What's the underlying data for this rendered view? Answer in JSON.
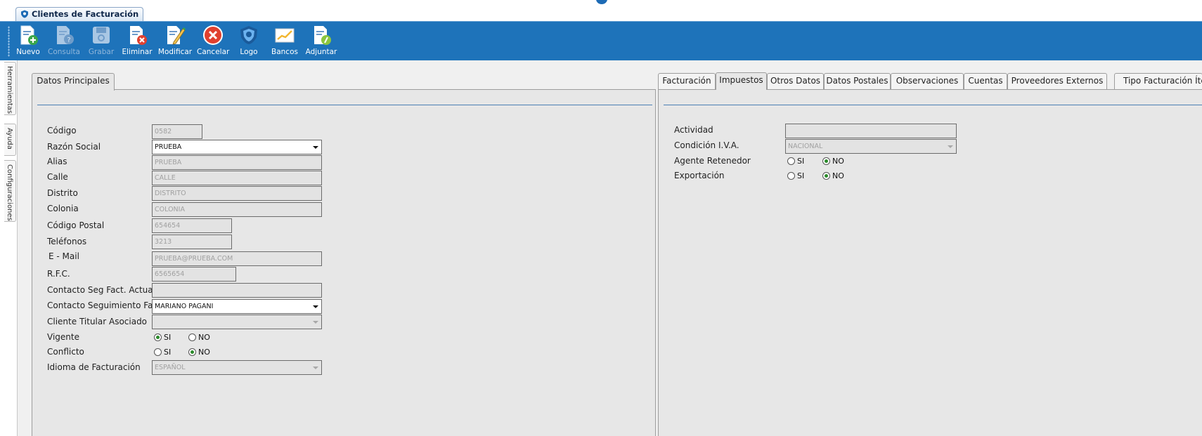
{
  "window": {
    "tab_title": "Clientes de Facturación"
  },
  "toolbar": {
    "buttons": [
      {
        "label": "Nuevo",
        "icon": "new-document-icon",
        "enabled": true
      },
      {
        "label": "Consulta",
        "icon": "query-document-icon",
        "enabled": false
      },
      {
        "label": "Grabar",
        "icon": "save-disk-icon",
        "enabled": false
      },
      {
        "label": "Eliminar",
        "icon": "delete-document-icon",
        "enabled": true
      },
      {
        "label": "Modificar",
        "icon": "edit-document-icon",
        "enabled": true
      },
      {
        "label": "Cancelar",
        "icon": "cancel-icon",
        "enabled": true
      },
      {
        "label": "Logo",
        "icon": "logo-icon",
        "enabled": true
      },
      {
        "label": "Bancos",
        "icon": "chart-icon",
        "enabled": true
      },
      {
        "label": "Adjuntar",
        "icon": "attach-document-icon",
        "enabled": true
      }
    ]
  },
  "side_tabs": [
    "Herramientas",
    "Ayuda",
    "Configuraciones"
  ],
  "left_pane": {
    "tab": "Datos Principales",
    "fields": {
      "codigo": {
        "label": "Código",
        "value": "0582"
      },
      "razon_social": {
        "label": "Razón Social",
        "value": "PRUEBA"
      },
      "alias": {
        "label": "Alias",
        "value": "PRUEBA"
      },
      "calle": {
        "label": "Calle",
        "value": "CALLE"
      },
      "distrito": {
        "label": "Distrito",
        "value": "DISTRITO"
      },
      "colonia": {
        "label": "Colonia",
        "value": "COLONIA"
      },
      "codigo_postal": {
        "label": "Código Postal",
        "value": "654654"
      },
      "telefonos": {
        "label": "Teléfonos",
        "value": "3213"
      },
      "email": {
        "label": "E - Mail",
        "value": "PRUEBA@PRUEBA.COM"
      },
      "rfc": {
        "label": "R.F.C.",
        "value": "6565654"
      },
      "contacto_seg_actual": {
        "label": "Contacto Seg Fact. Actual",
        "value": ""
      },
      "contacto_seguimiento": {
        "label": "Contacto Seguimiento Fact.",
        "value": "MARIANO PAGANI"
      },
      "cliente_titular": {
        "label": "Cliente Titular Asociado",
        "value": ""
      },
      "vigente": {
        "label": "Vigente",
        "options": [
          "SI",
          "NO"
        ],
        "selected": "SI"
      },
      "conflicto": {
        "label": "Conflicto",
        "options": [
          "SI",
          "NO"
        ],
        "selected": "NO"
      },
      "idioma": {
        "label": "Idioma de Facturación",
        "value": "ESPAÑOL"
      }
    }
  },
  "right_pane": {
    "tabs": [
      "Facturación",
      "Impuestos",
      "Otros Datos",
      "Datos Postales",
      "Observaciones",
      "Cuentas",
      "Proveedores Externos",
      "Tipo Facturación Íte"
    ],
    "active_tab": "Impuestos",
    "fields": {
      "actividad": {
        "label": "Actividad",
        "value": ""
      },
      "condicion_iva": {
        "label": "Condición I.V.A.",
        "value": "NACIONAL"
      },
      "agente_retenedor": {
        "label": "Agente Retenedor",
        "options": [
          "SI",
          "NO"
        ],
        "selected": "NO"
      },
      "exportacion": {
        "label": "Exportación",
        "options": [
          "SI",
          "NO"
        ],
        "selected": "NO"
      }
    }
  }
}
